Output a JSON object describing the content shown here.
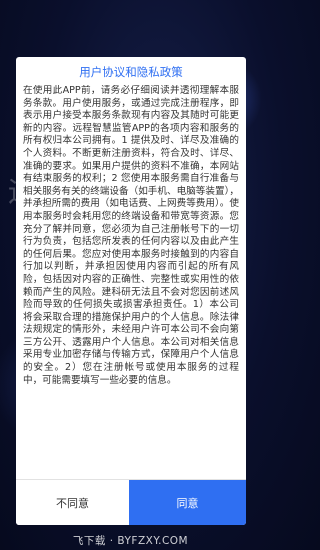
{
  "background": {
    "partial_text": "运"
  },
  "dialog": {
    "title": "用户协议和隐私政策",
    "body": "在使用此APP前，请务必仔细阅读并透彻理解本服务条款。用户使用服务，或通过完成注册程序，即表示用户接受本服务条款现有内容及其随时可能更新的内容。远程智慧监管APP的各项内容和服务的所有权归本公司拥有。1 提供及时、详尽及准确的个人资料。不断更新注册资料，符合及时、详尽、准确的要求。如果用户提供的资料不准确，本网站有结束服务的权利；2 您使用本服务需自行准备与相关服务有关的终端设备（如手机、电脑等装置），并承担所需的费用（如电话费、上网费等费用）。使用本服务时会耗用您的终端设备和带宽等资源。您充分了解并同意，您必须为自己注册帐号下的一切行为负责，包括您所发表的任何内容以及由此产生的任何后果。您应对使用本服务时接触到的内容自行加以判断，并承担因使用内容而引起的所有风险，包括因对内容的正确性、完整性或实用性的依赖而产生的风险。建科研无法且不会对您因前述风险而导致的任何损失或损害承担责任。1）本公司将会采取合理的措施保护用户的个人信息。除法律法规规定的情形外，未经用户许可本公司不会向第三方公开、透露用户个人信息。本公司对相关信息采用专业加密存储与传输方式，保障用户个人信息的安全。2）您在注册帐号或使用本服务的过程中，可能需要填写一些必要的信息。",
    "decline_label": "不同意",
    "agree_label": "同意"
  },
  "watermark": "飞下载 · BYFZXY.COM",
  "colors": {
    "accent": "#2f6ff2",
    "background": "#0a0f2c"
  }
}
